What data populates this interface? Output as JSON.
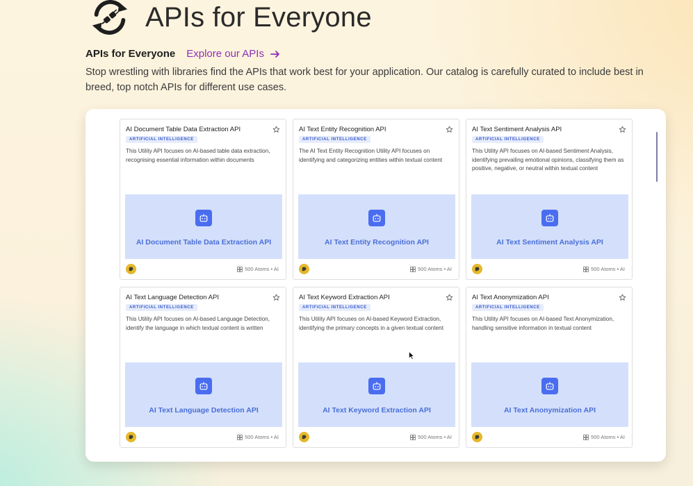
{
  "hero": {
    "title": "APIs for Everyone",
    "logo_icon": "plug-cycle-icon"
  },
  "subhead": {
    "title": "APIs for Everyone",
    "explore_label": "Explore our APIs",
    "explore_icon": "arrow-right-icon"
  },
  "description": "Stop wrestling with libraries find the APIs that work best for your application. Our catalog is carefully curated to include best in breed, top notch APIs for different use cases.",
  "cards": [
    {
      "title": "AI Document Table Data Extraction API",
      "badge": "ARTIFICIAL INTELLIGENCE",
      "description": "This Utility API focuses on AI-based table data extraction, recognising essential information within documents",
      "thumb_title": "AI Document Table Data Extraction API",
      "meta": "500 Atoms • AI"
    },
    {
      "title": "AI Text Entity Recognition API",
      "badge": "ARTIFICIAL INTELLIGENCE",
      "description": "The AI Text Entity Recognition Utility API focuses on identifying and categorizing entities within textual content",
      "thumb_title": "AI Text Entity Recognition API",
      "meta": "500 Atoms • AI"
    },
    {
      "title": "AI Text Sentiment Analysis API",
      "badge": "ARTIFICIAL INTELLIGENCE",
      "description": "This Utility API focuses on AI-based Sentiment Analysis, identifying prevailing emotional opinions, classifying them as positive, negative, or neutral within textual content",
      "thumb_title": "AI Text Sentiment Analysis API",
      "meta": "500 Atoms • AI"
    },
    {
      "title": "AI Text Language Detection API",
      "badge": "ARTIFICIAL INTELLIGENCE",
      "description": "This Utility API focuses on AI-based Language Detection, identify the language in which textual content is written",
      "thumb_title": "AI Text Language Detection API",
      "meta": "500 Atoms • AI"
    },
    {
      "title": "AI Text Keyword Extraction API",
      "badge": "ARTIFICIAL INTELLIGENCE",
      "description": "This Utility API focuses on AI-based Keyword Extraction, identifying the primary concepts in a given textual content",
      "thumb_title": "AI Text Keyword Extraction API",
      "meta": "500 Atoms • AI"
    },
    {
      "title": "AI Text Anonymization API",
      "badge": "ARTIFICIAL INTELLIGENCE",
      "description": "This Utility API focuses on AI-based Text Anonymization, handling sensitive information in textual content",
      "thumb_title": "AI Text Anonymization API",
      "meta": "500 Atoms • AI"
    }
  ],
  "colors": {
    "accent": "#8e2fb8",
    "badge_text": "#3a5ccc",
    "thumb_bg": "#d4e0fb",
    "thumb_icon_bg": "#4a6df0",
    "avatar": "#e5b82a"
  }
}
